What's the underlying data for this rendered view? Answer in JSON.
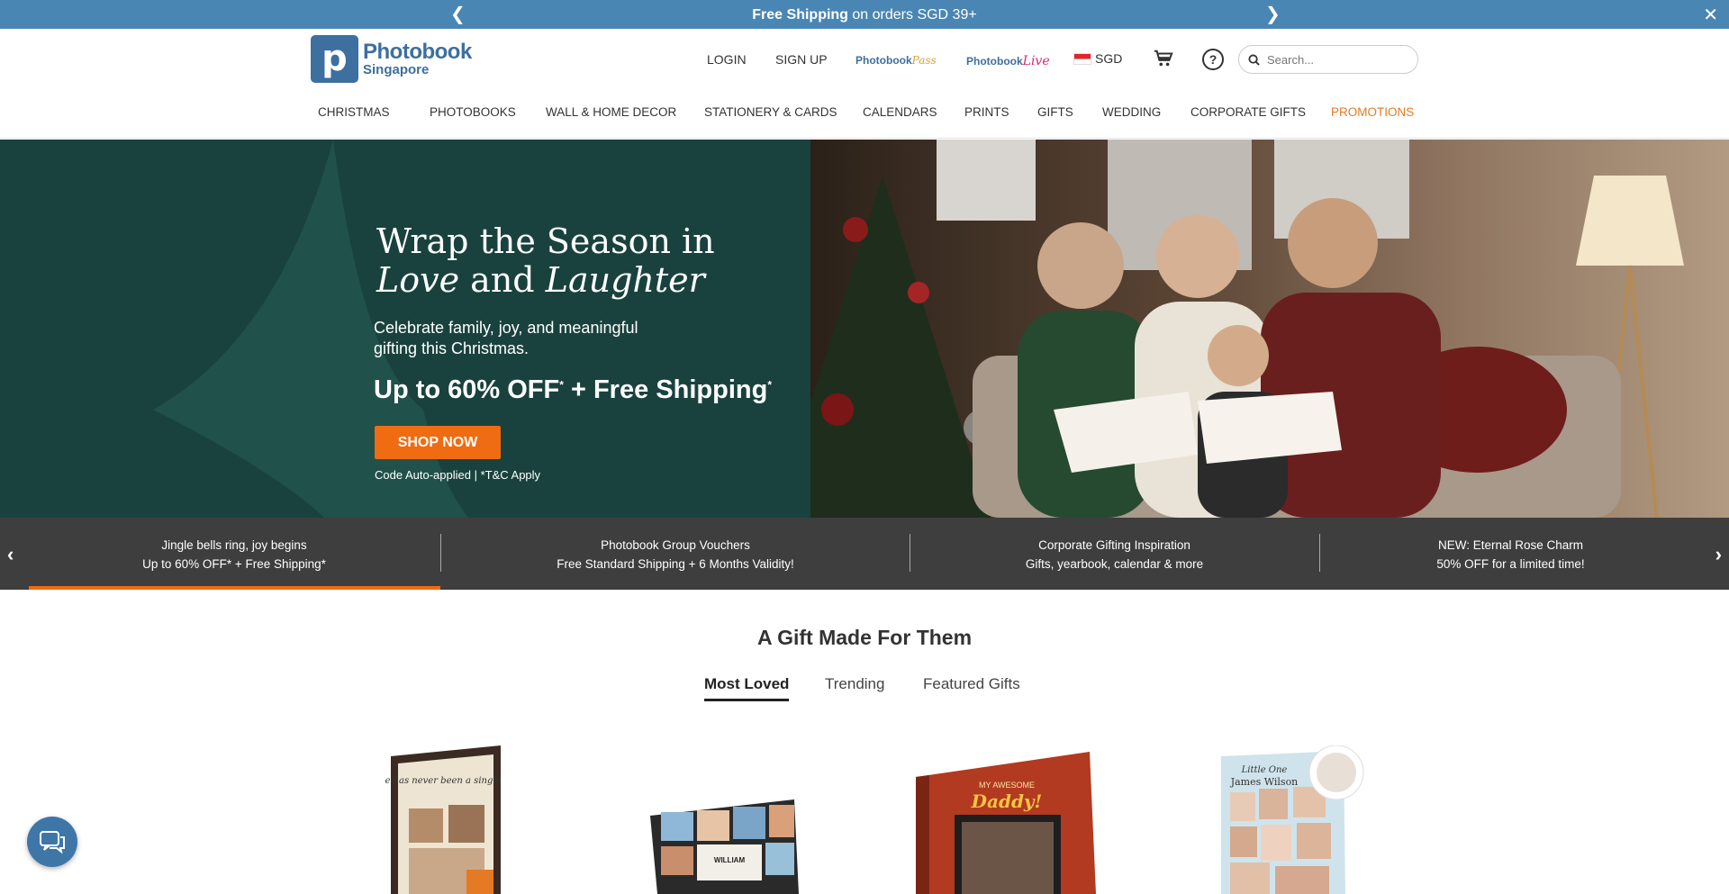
{
  "topbar": {
    "message_bold": "Free Shipping",
    "message_rest": " on orders SGD 39+",
    "prev_icon": "chevron-left-icon",
    "next_icon": "chevron-right-icon",
    "close_icon": "close-icon"
  },
  "header": {
    "logo_line1": "Photobook",
    "logo_line2": "Singapore",
    "logo_mark": "p",
    "login": "LOGIN",
    "signup": "SIGN UP",
    "pass_brand": "Photobook",
    "pass_script": "Pass",
    "live_brand": "Photobook",
    "live_script": "Live",
    "currency": "SGD",
    "search_placeholder": "Search...",
    "help_glyph": "?"
  },
  "nav": {
    "items": [
      "CHRISTMAS",
      "PHOTOBOOKS",
      "WALL & HOME DECOR",
      "STATIONERY & CARDS",
      "CALENDARS",
      "PRINTS",
      "GIFTS",
      "WEDDING",
      "CORPORATE GIFTS",
      "PROMOTIONS"
    ]
  },
  "hero": {
    "title_line1": "Wrap the Season in",
    "title_em1": "Love",
    "title_and": " and ",
    "title_em2": "Laughter",
    "subtitle": "Celebrate family, joy, and meaningful gifting this Christmas.",
    "offer_main": "Up to 60% OFF",
    "offer_free": " + Free Shipping",
    "offer_star": "*",
    "cta": "SHOP NOW",
    "note": "Code Auto-applied  |  *T&C Apply"
  },
  "promo_strip": [
    {
      "line1": "Jingle bells ring, joy begins",
      "line2": "Up to 60% OFF* + Free Shipping*"
    },
    {
      "line1": "Photobook Group Vouchers",
      "line2": "Free Standard Shipping + 6 Months Validity!"
    },
    {
      "line1": "Corporate Gifting Inspiration",
      "line2": "Gifts, yearbook, calendar & more"
    },
    {
      "line1": "NEW: Eternal Rose Charm",
      "line2": "50% OFF for a limited time!"
    }
  ],
  "gift_section": {
    "title": "A Gift Made For Them",
    "tabs": [
      "Most Loved",
      "Trending",
      "Featured Gifts"
    ],
    "active_tab": 0,
    "product_texts": {
      "frame_quote": "Home has never been a single place",
      "calendar_name": "WILLIAM",
      "book_title": "Daddy!",
      "book_top": "MY AWESOME",
      "collage_top": "Little One",
      "collage_name": "James Wilson"
    }
  },
  "colors": {
    "topbar": "#4a86b4",
    "brand_blue": "#3d6fa0",
    "promo_orange": "#e47a24",
    "cta_orange": "#ef6c12",
    "hero_green": "#19423e"
  }
}
